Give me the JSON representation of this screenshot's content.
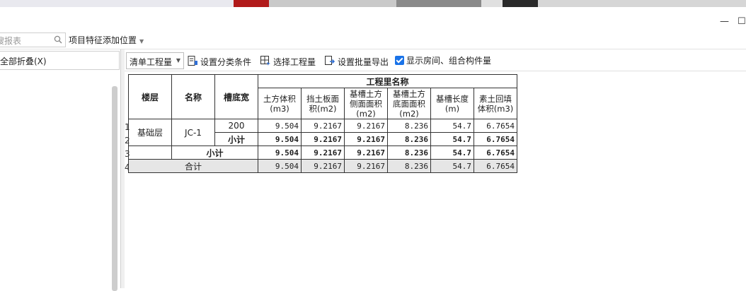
{
  "window": {
    "minimize_glyph": "—",
    "maximize_glyph": "☐"
  },
  "search": {
    "placeholder": "搜报表"
  },
  "feature_button": {
    "label": "项目特征添加位置"
  },
  "left_panel": {
    "collapse_label": "全部折叠(X)"
  },
  "toolbar": {
    "mode_select": "清单工程量",
    "set_category": "设置分类条件",
    "select_quantity": "选择工程量",
    "batch_export": "设置批量导出",
    "show_rooms_label": "显示房间、组合构件量",
    "show_rooms_checked": true
  },
  "table": {
    "headers": {
      "floor": "楼层",
      "name": "名称",
      "trench_width": "槽底宽",
      "group": "工程里名称",
      "earth_volume": "土方体积(m3)",
      "retaining_area": "挡土板面积(m2)",
      "trench_side_area": "基槽土方侧面面积(m2)",
      "trench_bottom_area": "基槽土方底面面积(m2)",
      "trench_length": "基槽长度(m)",
      "backfill_volume": "素土回填体积(m3)"
    },
    "row_numbers": [
      "1",
      "2",
      "3",
      "4"
    ],
    "floor_value": "基础层",
    "name_value": "JC-1",
    "rows": [
      {
        "width": "200",
        "vals": [
          "9.504",
          "9.2167",
          "9.2167",
          "8.236",
          "54.7",
          "6.7654"
        ]
      },
      {
        "width": "小计",
        "vals": [
          "9.504",
          "9.2167",
          "9.2167",
          "8.236",
          "54.7",
          "6.7654"
        ]
      },
      {
        "label": "小计",
        "vals": [
          "9.504",
          "9.2167",
          "9.2167",
          "8.236",
          "54.7",
          "6.7654"
        ]
      },
      {
        "label": "合计",
        "vals": [
          "9.504",
          "9.2167",
          "9.2167",
          "8.236",
          "54.7",
          "6.7654"
        ]
      }
    ]
  }
}
